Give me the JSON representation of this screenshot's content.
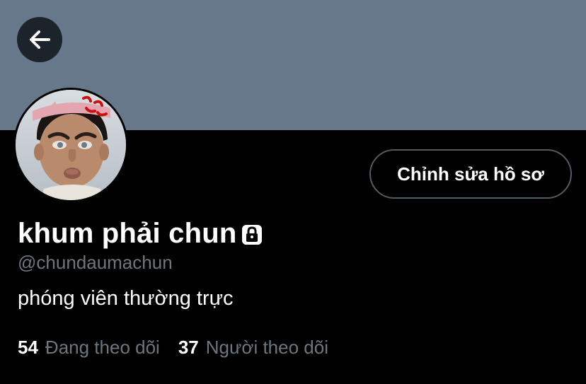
{
  "header": {
    "back_icon": "arrow-left-icon",
    "banner_color": "#66788a"
  },
  "profile": {
    "avatar_icon": "profile-avatar",
    "edit_button_label": "Chỉnh sửa hồ sơ",
    "display_name": "khum phải chun",
    "protected_icon": "lock-icon",
    "handle": "@chundaumachun",
    "bio": "phóng viên thường trực"
  },
  "stats": {
    "following_count": "54",
    "following_label": "Đang theo dõi",
    "followers_count": "37",
    "followers_label": "Người theo dõi"
  },
  "colors": {
    "background": "#000000",
    "secondary_text": "#6e767d",
    "button_border": "#535b62"
  }
}
